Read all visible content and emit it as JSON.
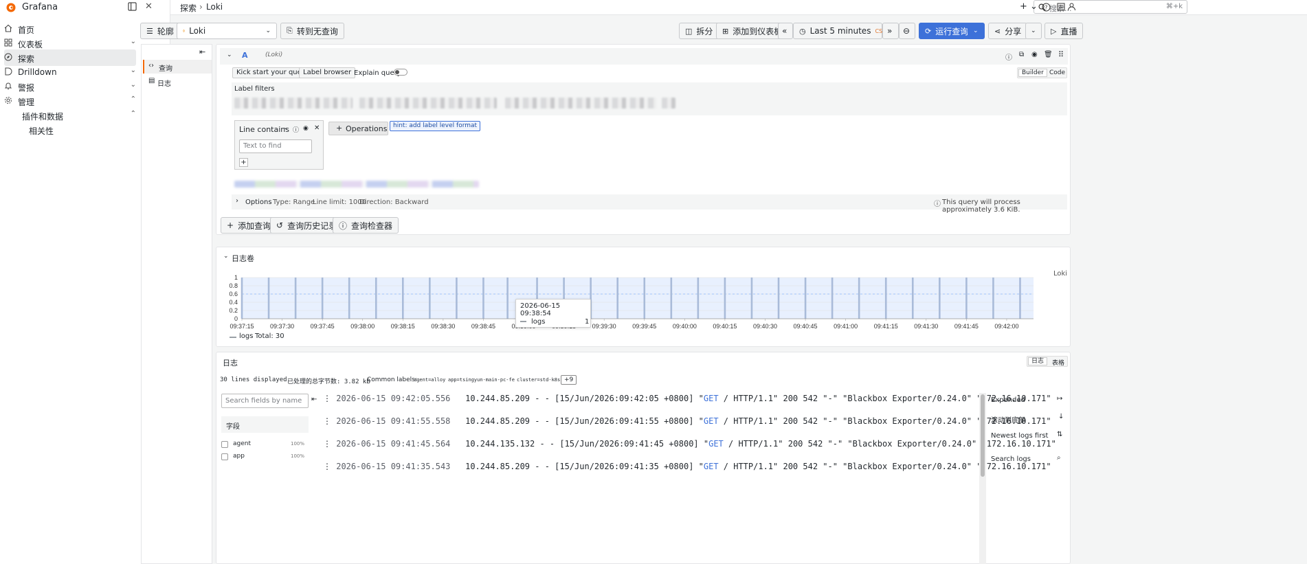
{
  "app": {
    "title": "Grafana"
  },
  "sidebar": {
    "items": [
      {
        "label": "首页",
        "icon": "home-icon"
      },
      {
        "label": "仪表板",
        "icon": "dashboard-grid-icon",
        "chevron": "⌄"
      },
      {
        "label": "探索",
        "icon": "compass-icon"
      },
      {
        "label": "Drilldown",
        "icon": "drilldown-icon",
        "chevron": "⌄"
      },
      {
        "label": "警报",
        "icon": "bell-icon",
        "chevron": "⌄"
      },
      {
        "label": "管理",
        "icon": "gear-icon",
        "chevron": "⌃"
      }
    ],
    "sub_items": [
      {
        "label": "插件和数据",
        "chevron": "⌃"
      },
      {
        "label": "相关性"
      }
    ]
  },
  "topbar": {
    "breadcrumb": [
      "探索",
      "Loki"
    ],
    "search_placeholder": "搜索...",
    "search_shortcut": "⌘+k"
  },
  "toolbar": {
    "outline": "轮廓",
    "datasource": "Loki",
    "go_queryless": "转到无查询",
    "split": "拆分",
    "add_to_dashboard": "添加到仪表板",
    "time_range": "Last 5 minutes",
    "timezone": "CST",
    "run_query": "运行查询",
    "share": "分享",
    "live": "直播"
  },
  "query_nav": {
    "items": [
      "查询",
      "日志"
    ]
  },
  "query": {
    "ref": "A",
    "datasource_label": "(Loki)",
    "kick_start": "Kick start your query",
    "label_browser": "Label browser",
    "explain_query": "Explain query",
    "explain_query_on": false,
    "mode_builder": "Builder",
    "mode_code": "Code",
    "label_filters_title": "Label filters",
    "line_contains": "Line contains",
    "text_to_find_placeholder": "Text to find",
    "operations": "Operations",
    "hint": "hint: add label level format",
    "options_label": "Options",
    "options_type": "Type: Range",
    "options_limit": "Line limit: 1000",
    "options_direction": "Direction: Backward",
    "process_info": "This query will process approximately 3.6 KiB."
  },
  "query_actions": {
    "add_query": "添加查询",
    "history": "查询历史记录",
    "inspector": "查询检查器"
  },
  "logs_volume": {
    "title": "日志卷",
    "legend_name": "logs",
    "legend_total": "Total: 30",
    "series_label": "Loki",
    "tooltip": {
      "time": "2026-06-15 09:38:54",
      "series": "logs",
      "value": "1"
    }
  },
  "chart_data": {
    "type": "bar",
    "title": "日志卷",
    "ylim": [
      0,
      1
    ],
    "yticks": [
      "0",
      "0.2",
      "0.4",
      "0.6",
      "0.8",
      "1"
    ],
    "xticks": [
      "09:37:15",
      "09:37:30",
      "09:37:45",
      "09:38:00",
      "09:38:15",
      "09:38:30",
      "09:38:45",
      "09:39:00",
      "09:39:15",
      "09:39:30",
      "09:39:45",
      "09:40:00",
      "09:40:15",
      "09:40:30",
      "09:40:45",
      "09:41:00",
      "09:41:15",
      "09:41:30",
      "09:41:45",
      "09:42:00"
    ],
    "series": [
      {
        "name": "logs",
        "color": "#8ab8ff",
        "x": [
          "09:37:15",
          "09:37:25",
          "09:37:35",
          "09:37:45",
          "09:37:55",
          "09:38:05",
          "09:38:15",
          "09:38:25",
          "09:38:35",
          "09:38:45",
          "09:38:54",
          "09:39:05",
          "09:39:15",
          "09:39:25",
          "09:39:35",
          "09:39:45",
          "09:39:55",
          "09:40:05",
          "09:40:15",
          "09:40:25",
          "09:40:35",
          "09:40:45",
          "09:40:55",
          "09:41:05",
          "09:41:15",
          "09:41:25",
          "09:41:35",
          "09:41:45",
          "09:41:55",
          "09:42:05"
        ],
        "values": [
          1,
          1,
          1,
          1,
          1,
          1,
          1,
          1,
          1,
          1,
          1,
          1,
          1,
          1,
          1,
          1,
          1,
          1,
          1,
          1,
          1,
          1,
          1,
          1,
          1,
          1,
          1,
          1,
          1,
          1
        ]
      }
    ],
    "legend": "bottom-left",
    "grid": true
  },
  "logs": {
    "title": "日志",
    "view_logs": "日志",
    "view_table": "表格",
    "lines_displayed": "30 lines displayed",
    "bytes_processed": "已处理的总字节数: 3.82 kB",
    "common_labels_title": "Common labels:",
    "common_labels": [
      "agent=alloy",
      "app=tsingyun-main-pc-fe",
      "cluster=std-k8s"
    ],
    "more_labels": "+9",
    "search_fields_placeholder": "Search fields by name",
    "fields_title": "字段",
    "fields": [
      {
        "name": "agent",
        "pct": "100%"
      },
      {
        "name": "app",
        "pct": "100%"
      }
    ],
    "lines": [
      {
        "ts": "2026-06-15 09:42:05.556",
        "pre": "10.244.85.209 - - [15/Jun/2026:09:42:05 +0800] \"",
        "kw": "GET",
        "post": " / HTTP/1.1\" 200 542 \"-\" \"Blackbox Exporter/0.24.0\" \"172.16.10.171\""
      },
      {
        "ts": "2026-06-15 09:41:55.558",
        "pre": "10.244.85.209 - - [15/Jun/2026:09:41:55 +0800] \"",
        "kw": "GET",
        "post": " / HTTP/1.1\" 200 542 \"-\" \"Blackbox Exporter/0.24.0\" \"172.16.10.171\""
      },
      {
        "ts": "2026-06-15 09:41:45.564",
        "pre": "10.244.135.132 - - [15/Jun/2026:09:41:45 +0800] \"",
        "kw": "GET",
        "post": " / HTTP/1.1\" 200 542 \"-\" \"Blackbox Exporter/0.24.0\" \"172.16.10.171\""
      },
      {
        "ts": "2026-06-15 09:41:35.543",
        "pre": "10.244.85.209 - - [15/Jun/2026:09:41:35 +0800] \"",
        "kw": "GET",
        "post": " / HTTP/1.1\" 200 542 \"-\" \"Blackbox Exporter/0.24.0\" \"172.16.10.171\""
      }
    ],
    "side_controls": {
      "expanded": "Expanded",
      "scroll_bottom": "滚动到底部",
      "newest_first": "Newest logs first",
      "search_logs": "Search logs"
    }
  }
}
